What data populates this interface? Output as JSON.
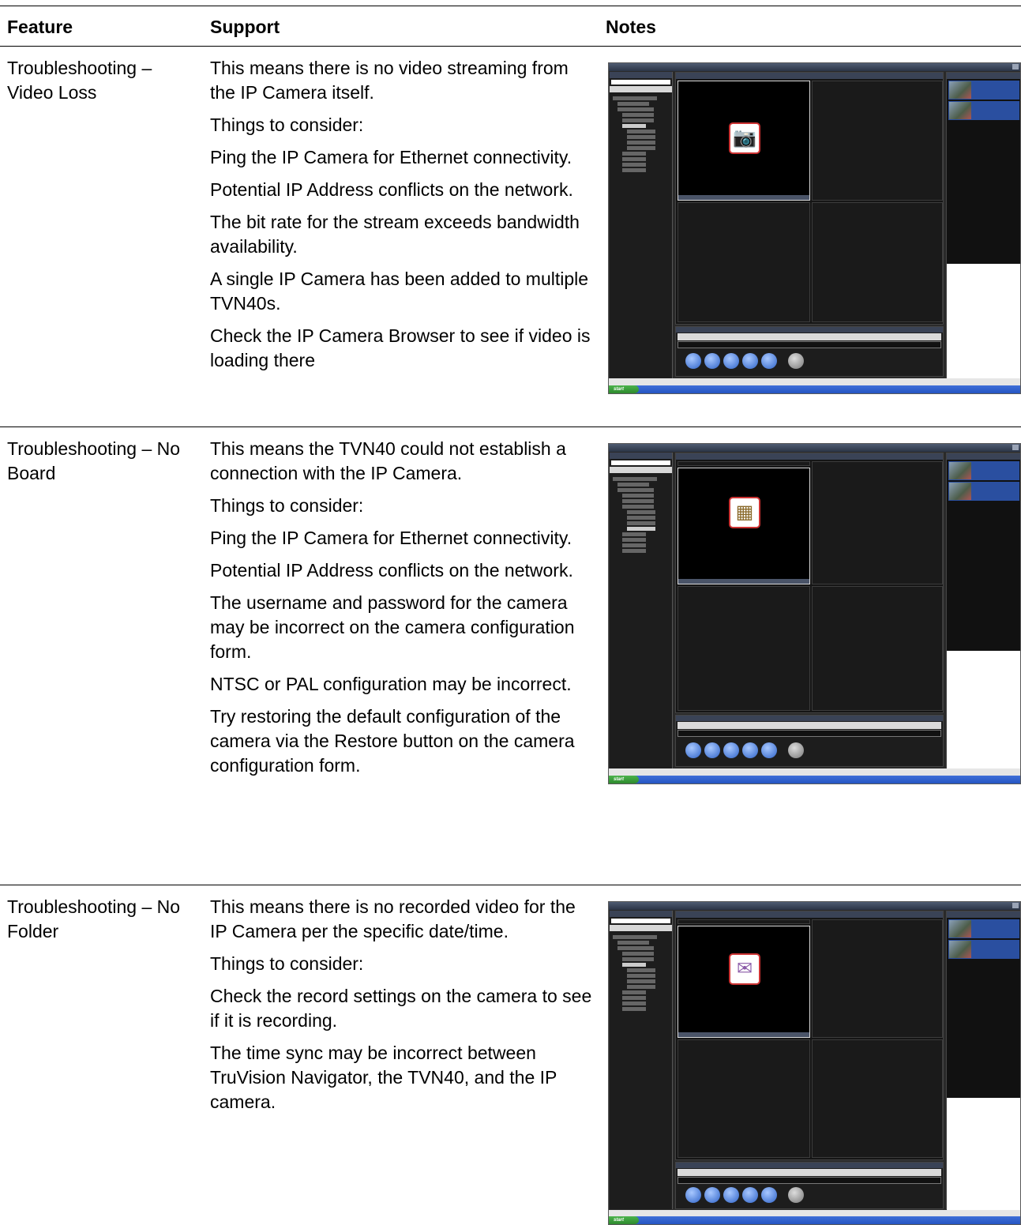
{
  "header": {
    "feature": "Feature",
    "support": "Support",
    "notes": "Notes"
  },
  "rows": [
    {
      "feature": "Troubleshooting – Video Loss",
      "support": [
        "This means there is no video streaming from the IP Camera itself.",
        "Things to consider:",
        "Ping the IP Camera for Ethernet connectivity.",
        "Potential IP Address conflicts on the network.",
        "The bit rate for the stream exceeds bandwidth availability.",
        "A single IP Camera has been added to multiple TVN40s.",
        "Check the IP Camera Browser to see if video is loading there"
      ],
      "screenshot": {
        "icon": "video-loss-icon",
        "glyph": "📷"
      }
    },
    {
      "feature": "Troubleshooting – No Board",
      "support": [
        "This means the TVN40 could not establish a connection with the IP Camera.",
        "Things to consider:",
        "Ping the IP Camera for Ethernet connectivity.",
        "Potential IP Address conflicts on the network.",
        "The username and password for the camera may be incorrect on the camera configuration form.",
        "NTSC or PAL configuration may be incorrect.",
        "Try restoring the default configuration of the camera via the Restore button on the camera configuration form."
      ],
      "screenshot": {
        "icon": "no-board-icon",
        "glyph": "▦"
      }
    },
    {
      "feature": "Troubleshooting – No Folder",
      "support": [
        "This means there is no recorded video for the IP Camera per the specific date/time.",
        "Things to consider:",
        "Check the record settings on the camera to see if it is recording.",
        "The time sync may be incorrect between TruVision Navigator, the TVN40, and the IP camera."
      ],
      "screenshot": {
        "icon": "no-folder-icon",
        "glyph": "✉"
      }
    }
  ]
}
